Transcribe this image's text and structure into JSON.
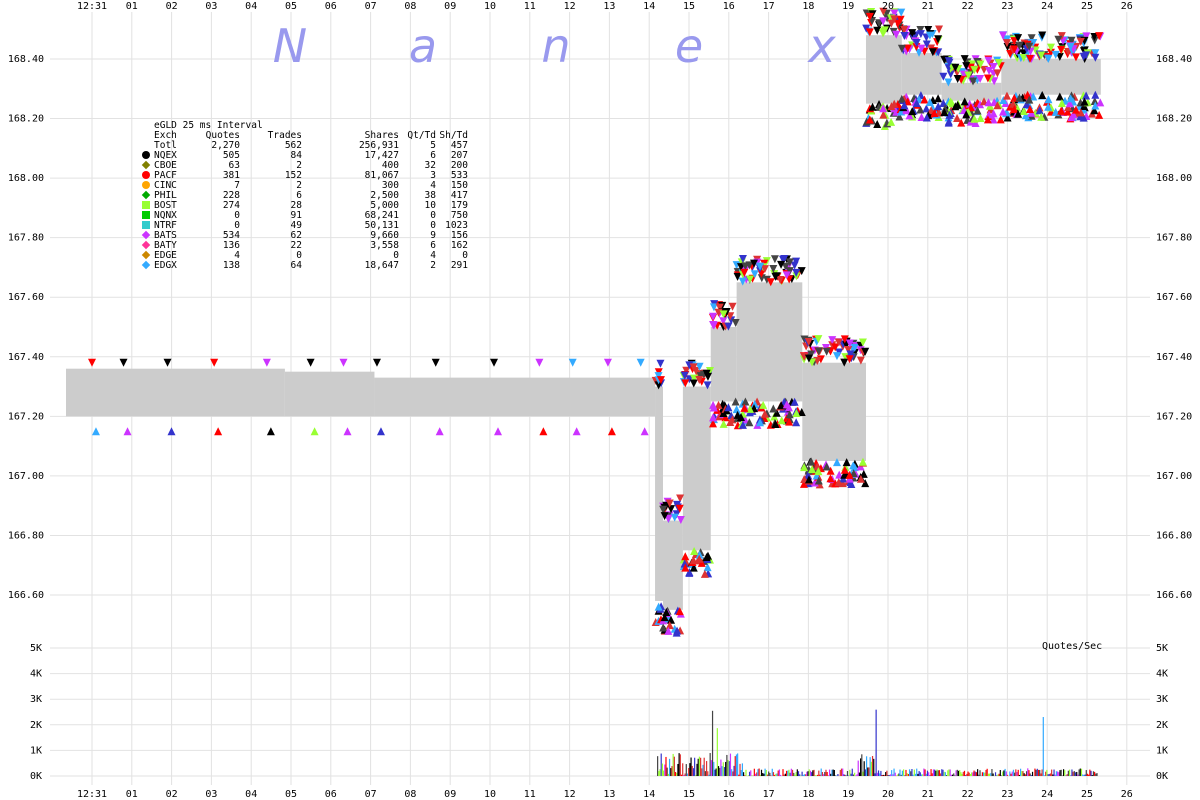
{
  "watermark_letters": [
    "N",
    "a",
    "n",
    "e",
    "x"
  ],
  "stats": {
    "title": "eGLD 25 ms Interval",
    "headers": {
      "exch": "Exch",
      "quotes": "Quotes",
      "trades": "Trades",
      "shares": "Shares",
      "qt_td": "Qt/Td",
      "sh_td": "Sh/Td"
    },
    "rows": [
      {
        "exch": "Totl",
        "quotes": "2,270",
        "trades": "562",
        "shares": "256,931",
        "qt_td": "5",
        "sh_td": "457",
        "color": "",
        "marker": ""
      },
      {
        "exch": "NQEX",
        "quotes": "505",
        "trades": "84",
        "shares": "17,427",
        "qt_td": "6",
        "sh_td": "207",
        "color": "#000000",
        "marker": "circle"
      },
      {
        "exch": "CBOE",
        "quotes": "63",
        "trades": "2",
        "shares": "400",
        "qt_td": "32",
        "sh_td": "200",
        "color": "#808000",
        "marker": "diamond"
      },
      {
        "exch": "PACF",
        "quotes": "381",
        "trades": "152",
        "shares": "81,067",
        "qt_td": "3",
        "sh_td": "533",
        "color": "#ff0000",
        "marker": "circle"
      },
      {
        "exch": "CINC",
        "quotes": "7",
        "trades": "2",
        "shares": "300",
        "qt_td": "4",
        "sh_td": "150",
        "color": "#ffa500",
        "marker": "circle"
      },
      {
        "exch": "PHIL",
        "quotes": "228",
        "trades": "6",
        "shares": "2,500",
        "qt_td": "38",
        "sh_td": "417",
        "color": "#00aa00",
        "marker": "diamond"
      },
      {
        "exch": "BOST",
        "quotes": "274",
        "trades": "28",
        "shares": "5,000",
        "qt_td": "10",
        "sh_td": "179",
        "color": "#99ff33",
        "marker": "square"
      },
      {
        "exch": "NQNX",
        "quotes": "0",
        "trades": "91",
        "shares": "68,241",
        "qt_td": "0",
        "sh_td": "750",
        "color": "#00cc00",
        "marker": "square"
      },
      {
        "exch": "NTRF",
        "quotes": "0",
        "trades": "49",
        "shares": "50,131",
        "qt_td": "0",
        "sh_td": "1023",
        "color": "#33cccc",
        "marker": "square"
      },
      {
        "exch": "BATS",
        "quotes": "534",
        "trades": "62",
        "shares": "9,660",
        "qt_td": "9",
        "sh_td": "156",
        "color": "#cc33ff",
        "marker": "diamond"
      },
      {
        "exch": "BATY",
        "quotes": "136",
        "trades": "22",
        "shares": "3,558",
        "qt_td": "6",
        "sh_td": "162",
        "color": "#ff3399",
        "marker": "diamond"
      },
      {
        "exch": "EDGE",
        "quotes": "4",
        "trades": "0",
        "shares": "0",
        "qt_td": "4",
        "sh_td": "0",
        "color": "#cc8800",
        "marker": "diamond"
      },
      {
        "exch": "EDGX",
        "quotes": "138",
        "trades": "64",
        "shares": "18,647",
        "qt_td": "2",
        "sh_td": "291",
        "color": "#33aaff",
        "marker": "diamond"
      }
    ]
  },
  "qps_label": "Quotes/Sec",
  "chart_data": {
    "type": "scatter",
    "x_ticks": [
      "12:31",
      "01",
      "02",
      "03",
      "04",
      "05",
      "06",
      "07",
      "08",
      "09",
      "10",
      "11",
      "12",
      "13",
      "14",
      "15",
      "16",
      "17",
      "18",
      "19",
      "20",
      "21",
      "22",
      "23",
      "24",
      "25",
      "26"
    ],
    "x_range": [
      0,
      26.2
    ],
    "price_ticks": [
      "168.40",
      "168.20",
      "168.00",
      "167.80",
      "167.60",
      "167.40",
      "167.20",
      "167.00",
      "166.80",
      "166.60"
    ],
    "price_range": [
      166.465,
      168.525
    ],
    "volume_ticks": [
      "5K",
      "4K",
      "3K",
      "2K",
      "1K",
      "0K"
    ],
    "volume_range": [
      0,
      5000
    ],
    "grid": true,
    "nbbo_band": [
      {
        "x0": 0,
        "x1": 5.5,
        "low": 167.2,
        "high": 167.36
      },
      {
        "x0": 5.5,
        "x1": 7.75,
        "low": 167.2,
        "high": 167.35
      },
      {
        "x0": 7.75,
        "x1": 14.8,
        "low": 167.2,
        "high": 167.33
      },
      {
        "x0": 14.8,
        "x1": 15.0,
        "low": 166.58,
        "high": 167.3
      },
      {
        "x0": 15.0,
        "x1": 15.5,
        "low": 166.55,
        "high": 166.85
      },
      {
        "x0": 15.5,
        "x1": 16.2,
        "low": 166.75,
        "high": 167.3
      },
      {
        "x0": 16.2,
        "x1": 16.85,
        "low": 167.25,
        "high": 167.5
      },
      {
        "x0": 16.85,
        "x1": 18.5,
        "low": 167.25,
        "high": 167.65
      },
      {
        "x0": 18.5,
        "x1": 20.1,
        "low": 167.05,
        "high": 167.38
      },
      {
        "x0": 20.1,
        "x1": 21.0,
        "low": 168.25,
        "high": 168.48
      },
      {
        "x0": 21.0,
        "x1": 22.0,
        "low": 168.28,
        "high": 168.42
      },
      {
        "x0": 22.0,
        "x1": 23.5,
        "low": 168.26,
        "high": 168.32
      },
      {
        "x0": 23.5,
        "x1": 26.0,
        "low": 168.28,
        "high": 168.4
      }
    ]
  }
}
